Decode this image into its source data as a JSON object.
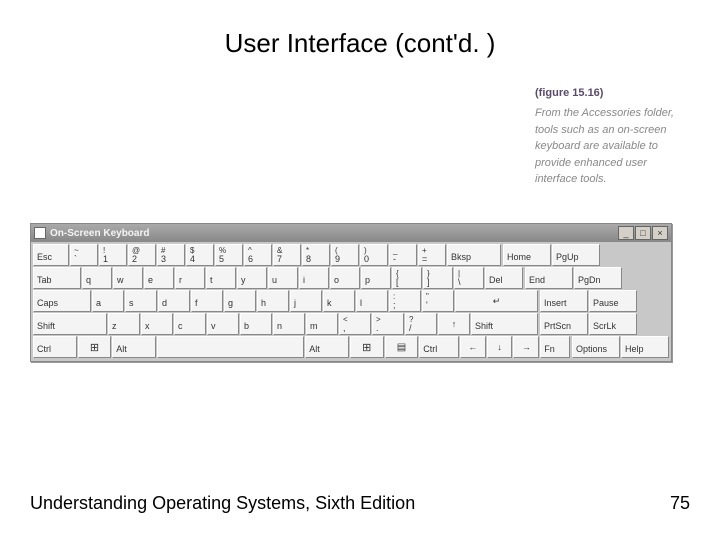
{
  "title": "User Interface (cont'd. )",
  "caption": {
    "label": "(figure 15.16)",
    "text": "From the Accessories folder, tools such as an on-screen keyboard are available to provide enhanced user interface tools."
  },
  "window": {
    "title": "On-Screen Keyboard",
    "buttons": {
      "min": "_",
      "max": "□",
      "close": "×"
    }
  },
  "rows": {
    "r1": {
      "esc": "Esc",
      "keys": [
        {
          "u": "~",
          "l": "`"
        },
        {
          "u": "!",
          "l": "1"
        },
        {
          "u": "@",
          "l": "2"
        },
        {
          "u": "#",
          "l": "3"
        },
        {
          "u": "$",
          "l": "4"
        },
        {
          "u": "%",
          "l": "5"
        },
        {
          "u": "^",
          "l": "6"
        },
        {
          "u": "&",
          "l": "7"
        },
        {
          "u": "*",
          "l": "8"
        },
        {
          "u": "(",
          "l": "9"
        },
        {
          "u": ")",
          "l": "0"
        },
        {
          "u": "_",
          "l": "-"
        },
        {
          "u": "+",
          "l": "="
        }
      ],
      "bksp": "Bksp",
      "nav": [
        "Home",
        "PgUp"
      ]
    },
    "r2": {
      "tab": "Tab",
      "keys": [
        "q",
        "w",
        "e",
        "r",
        "t",
        "y",
        "u",
        "i",
        "o",
        "p"
      ],
      "br1": {
        "u": "{",
        "l": "["
      },
      "br2": {
        "u": "}",
        "l": "]"
      },
      "bs": {
        "u": "|",
        "l": "\\"
      },
      "del": "Del",
      "nav": [
        "End",
        "PgDn"
      ]
    },
    "r3": {
      "caps": "Caps",
      "keys": [
        "a",
        "s",
        "d",
        "f",
        "g",
        "h",
        "j",
        "k",
        "l"
      ],
      "sc": {
        "u": ":",
        "l": ";"
      },
      "qt": {
        "u": "\"",
        "l": "'"
      },
      "enter": "↵",
      "nav": [
        "Insert",
        "Pause"
      ]
    },
    "r4": {
      "shiftL": "Shift",
      "keys": [
        "z",
        "x",
        "c",
        "v",
        "b",
        "n",
        "m"
      ],
      "cm": {
        "u": "<",
        "l": ","
      },
      "pd": {
        "u": ">",
        "l": "."
      },
      "sl": {
        "u": "?",
        "l": "/"
      },
      "up": "↑",
      "shiftR": "Shift",
      "nav": [
        "PrtScn",
        "ScrLk"
      ]
    },
    "r5": {
      "ctrlL": "Ctrl",
      "altL": "Alt",
      "altR": "Alt",
      "ctrlR": "Ctrl",
      "left": "←",
      "down": "↓",
      "right": "→",
      "fn": "Fn",
      "nav": [
        "Options",
        "Help"
      ]
    }
  },
  "footer": {
    "book": "Understanding Operating Systems, Sixth Edition",
    "page": "75"
  }
}
